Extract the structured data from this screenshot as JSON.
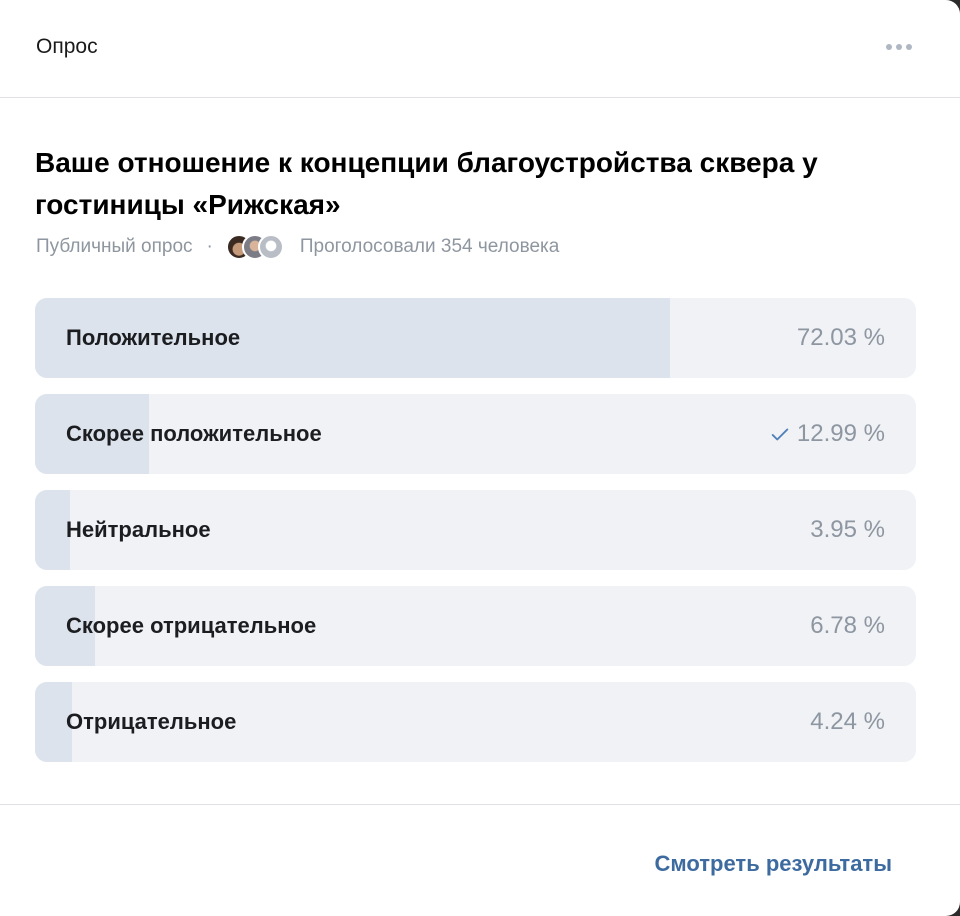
{
  "header": {
    "title": "Опрос",
    "more_icon": "more-dots-icon"
  },
  "poll": {
    "question": "Ваше отношение к концепции благоустройства сквера у гостиницы «Рижская»",
    "type_label": "Публичный опрос",
    "separator": "·",
    "votes_label": "Проголосовали 354 человека",
    "options": [
      {
        "label": "Положительное",
        "percent_text": "72.03 %",
        "percent": 72.03,
        "voted": false
      },
      {
        "label": "Скорее положительное",
        "percent_text": "12.99 %",
        "percent": 12.99,
        "voted": true
      },
      {
        "label": "Нейтральное",
        "percent_text": "3.95 %",
        "percent": 3.95,
        "voted": false
      },
      {
        "label": "Скорее отрицательное",
        "percent_text": "6.78 %",
        "percent": 6.78,
        "voted": false
      },
      {
        "label": "Отрицательное",
        "percent_text": "4.24 %",
        "percent": 4.24,
        "voted": false
      }
    ]
  },
  "footer": {
    "results_label": "Смотреть результаты"
  },
  "colors": {
    "accent": "#3d6b9f",
    "bar_fill": "#dce3ec",
    "bar_bg": "#f0f2f5",
    "muted": "#8d96a1"
  }
}
